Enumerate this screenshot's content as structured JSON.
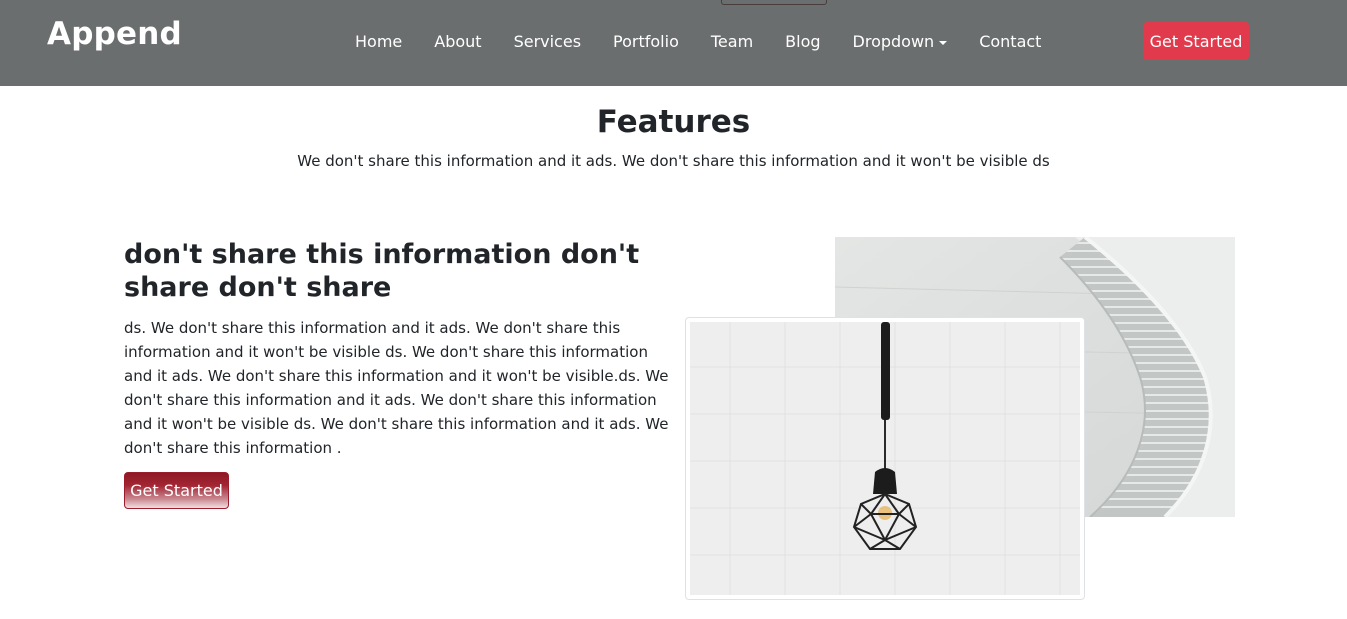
{
  "header": {
    "logo": "Append",
    "nav": [
      "Home",
      "About",
      "Services",
      "Portfolio",
      "Team",
      "Blog",
      "Dropdown",
      "Contact"
    ],
    "cta": "Get Started"
  },
  "features": {
    "title": "Features",
    "subtitle": "We don't share this information and it ads. We don't share this information and it won't be visible ds",
    "heading": "don't share this information don't share don't share",
    "body": "ds. We don't share this information and it ads. We don't share this information and it won't be visible ds. We don't share this information and it ads. We don't share this information and it won't be visible.ds. We don't share this information and it ads. We don't share this information and it won't be visible ds. We don't share this information and it ads. We don't share this information .",
    "cta": "Get Started"
  },
  "colors": {
    "header_bg": "#6b6e6e",
    "accent": "#e03a4c",
    "button_dark": "#8b1a25"
  },
  "icons": {
    "dropdown": "caret-down-icon"
  }
}
